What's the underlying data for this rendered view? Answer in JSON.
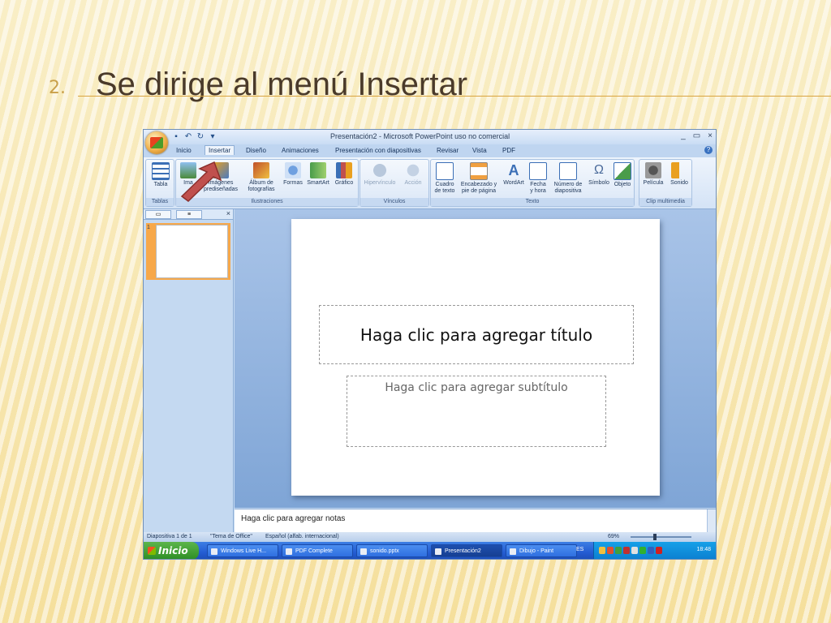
{
  "slide": {
    "number": "2.",
    "title": "Se dirige al menú Insertar"
  },
  "window": {
    "title": "Presentación2 - Microsoft PowerPoint uso no comercial",
    "minimize": "_",
    "maximize": "▭",
    "close": "×"
  },
  "tabs": [
    {
      "label": "Inicio"
    },
    {
      "label": "Insertar",
      "active": true
    },
    {
      "label": "Diseño"
    },
    {
      "label": "Animaciones"
    },
    {
      "label": "Presentación con diapositivas"
    },
    {
      "label": "Revisar"
    },
    {
      "label": "Vista"
    },
    {
      "label": "PDF"
    }
  ],
  "ribbon": {
    "groups": {
      "tablas": "Tablas",
      "ilustraciones": "Ilustraciones",
      "vinculos": "Vínculos",
      "texto": "Texto",
      "clip": "Clip multimedia"
    },
    "buttons": {
      "tabla": "Tabla",
      "imagen": "Ima",
      "imagenes1": "Imágenes",
      "imagenes2": "prediseñadas",
      "album1": "Álbum de",
      "album2": "fotografías",
      "formas": "Formas",
      "smartart": "SmartArt",
      "grafico": "Gráfico",
      "hipervinculo": "Hipervínculo",
      "accion": "Acción",
      "cuadro1": "Cuadro",
      "cuadro2": "de texto",
      "encab1": "Encabezado y",
      "encab2": "pie de página",
      "wordart": "WordArt",
      "fecha1": "Fecha",
      "fecha2": "y hora",
      "numero1": "Número de",
      "numero2": "diapositiva",
      "simbolo": "Símbolo",
      "objeto": "Objeto",
      "pelicula": "Película",
      "sonido": "Sonido"
    }
  },
  "thumbnail": {
    "number": "1"
  },
  "placeholders": {
    "title": "Haga clic para agregar título",
    "subtitle": "Haga clic para agregar subtítulo"
  },
  "notes": "Haga clic para agregar notas",
  "status": {
    "slide": "Diapositiva 1 de 1",
    "theme": "\"Tema de Office\"",
    "language": "Español (alfab. internacional)",
    "zoom": "69%"
  },
  "taskbar": {
    "start": "Inicio",
    "tasks": [
      {
        "label": "Windows Live H..."
      },
      {
        "label": "PDF Complete"
      },
      {
        "label": "sonido.pptx"
      },
      {
        "label": "Presentación2",
        "active": true
      },
      {
        "label": "Dibujo - Paint"
      }
    ],
    "language": "ES",
    "clock": "18:48"
  },
  "colors": {
    "accent": "#d9a441",
    "arrow": "#c0504d",
    "ribbon": "#dbe7f7"
  }
}
